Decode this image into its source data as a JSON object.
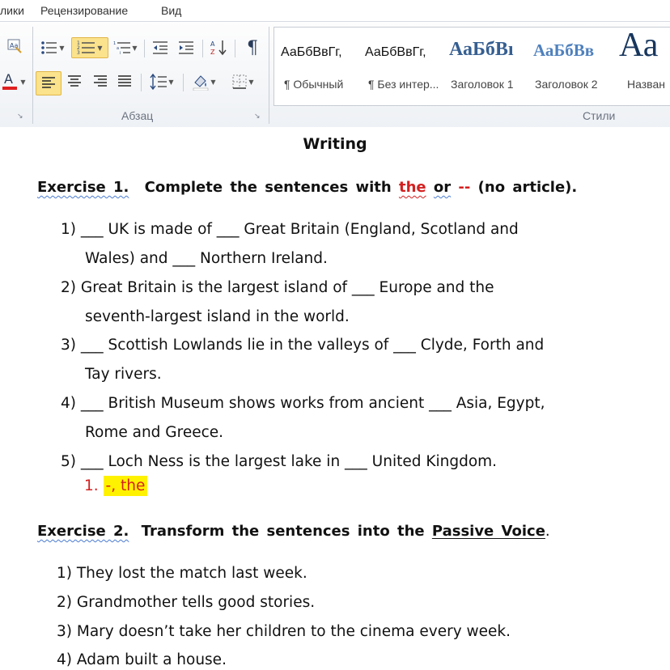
{
  "ribbon": {
    "tabs": [
      "лики",
      "Рецензирование",
      "Вид"
    ],
    "groups": {
      "paragraph": "Абзац",
      "styles": "Стили"
    },
    "styles": [
      {
        "sample": "АаБбВвГг,",
        "name": "¶ Обычный"
      },
      {
        "sample": "АаБбВвГг,",
        "name": "¶ Без интер..."
      },
      {
        "sample": "АаБбВı",
        "name": "Заголовок 1"
      },
      {
        "sample": "АаБбВв",
        "name": "Заголовок 2"
      },
      {
        "sample": "Аа",
        "name": "Назван"
      }
    ],
    "colors": {
      "heading_blue": "#365f91",
      "heading2_blue": "#4f81bd",
      "font_color_red": "#e02020",
      "highlight": "#fbe28c"
    }
  },
  "document": {
    "title": "Writing",
    "exercise1": {
      "label": "Exercise 1.",
      "prefix": "Complete the sentences with",
      "the_word": "the",
      "or_word": "or",
      "dash": "--",
      "suffix": "(no article).",
      "lines": [
        "1) ___ UK is made of ___ Great Britain (England, Scotland and",
        "Wales) and ___ Northern Ireland.",
        "2) Great Britain is the largest island of ___ Europe and the",
        "seventh-largest island in the world.",
        "3) ___ Scottish Lowlands lie in the valleys of ___ Clyde, Forth and",
        "Tay rivers.",
        "4) ___ British Museum shows works from ancient ___ Asia, Egypt,",
        "Rome and Greece.",
        "5) ___ Loch Ness is the largest lake in ___ United Kingdom."
      ],
      "answer_number": "1.",
      "answer_text": "-, the"
    },
    "exercise2": {
      "label": "Exercise 2.",
      "prefix": "Transform the sentences into the",
      "emphasis": "Passive Voice",
      "suffix": ".",
      "lines": [
        "1) They lost the match last week.",
        "2) Grandmother tells good stories.",
        "3) Mary doesn’t take her children to the cinema every week.",
        "4) Adam built a house."
      ]
    }
  }
}
